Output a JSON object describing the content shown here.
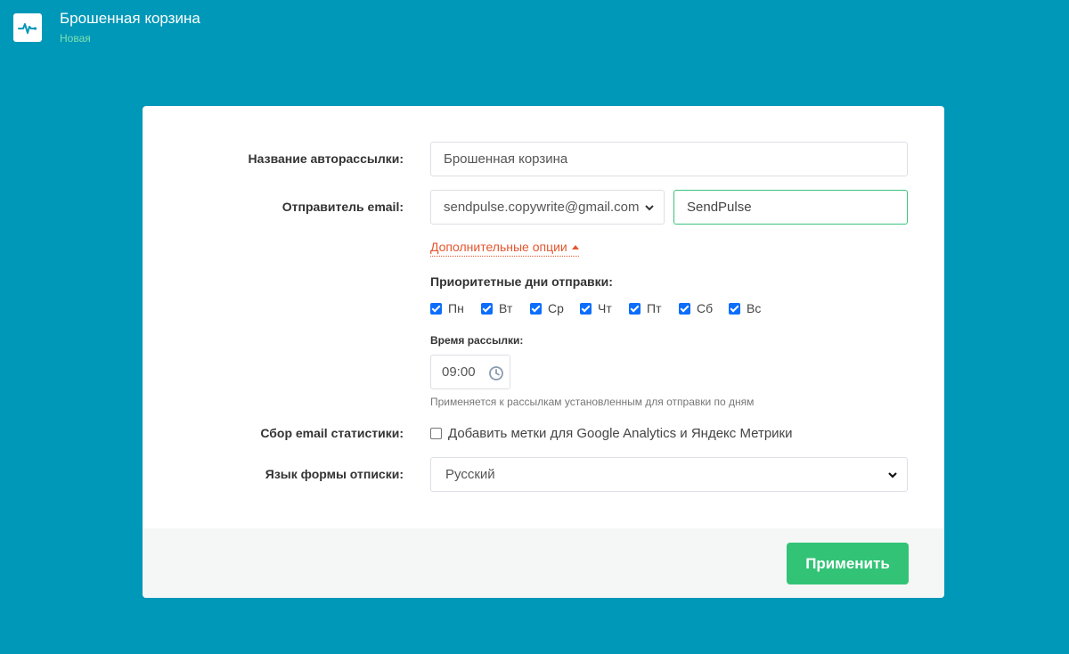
{
  "header": {
    "title": "Брошенная корзина",
    "status": "Новая"
  },
  "form": {
    "name": {
      "label": "Название авторассылки:",
      "value": "Брошенная корзина"
    },
    "sender": {
      "label": "Отправитель email:",
      "email": "sendpulse.copywrite@gmail.com",
      "name_value": "SendPulse"
    },
    "advanced_link": "Дополнительные опции",
    "priority_days": {
      "label": "Приоритетные дни отправки:",
      "days": [
        {
          "label": "Пн",
          "checked": true
        },
        {
          "label": "Вт",
          "checked": true
        },
        {
          "label": "Ср",
          "checked": true
        },
        {
          "label": "Чт",
          "checked": true
        },
        {
          "label": "Пт",
          "checked": true
        },
        {
          "label": "Сб",
          "checked": true
        },
        {
          "label": "Вс",
          "checked": true
        }
      ]
    },
    "send_time": {
      "label": "Время рассылки:",
      "value": "09:00",
      "hint": "Применяется к рассылкам установленным для отправки по дням"
    },
    "stats": {
      "label": "Сбор email статистики:",
      "option": "Добавить метки для Google Analytics и Яндекс Метрики",
      "checked": false
    },
    "language": {
      "label": "Язык формы отписки:",
      "value": "Русский"
    }
  },
  "footer": {
    "apply_label": "Применить"
  },
  "colors": {
    "background": "#0098b8",
    "accent": "#33c376",
    "link": "#e4562f"
  }
}
